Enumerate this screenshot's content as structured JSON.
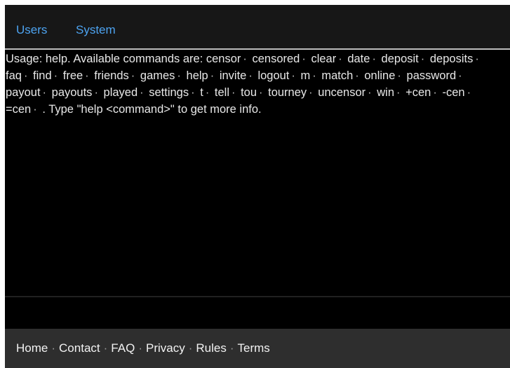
{
  "tabs": [
    {
      "label": "Users"
    },
    {
      "label": "System"
    }
  ],
  "console": {
    "prefix": "Usage: help. Available commands are: ",
    "commands": [
      "censor",
      "censored",
      "clear",
      "date",
      "deposit",
      "deposits",
      "faq",
      "find",
      "free",
      "friends",
      "games",
      "help",
      "invite",
      "logout",
      "m",
      "match",
      "online",
      "password",
      "payout",
      "payouts",
      "played",
      "settings",
      "t",
      "tell",
      "tou",
      "tourney",
      "uncensor",
      "win",
      "+cen",
      "-cen",
      "=cen",
      ""
    ],
    "separator": "·",
    "suffix": ". Type \"help <command>\" to get more info."
  },
  "input": {
    "value": "",
    "placeholder": ""
  },
  "footer": {
    "links": [
      "Home",
      "Contact",
      "FAQ",
      "Privacy",
      "Rules",
      "Terms"
    ],
    "separator": "·"
  },
  "colors": {
    "tab_text": "#4da3f0",
    "console_bg": "#000000",
    "console_text": "#e8e8e8",
    "footer_bg": "#2e2e2e"
  }
}
